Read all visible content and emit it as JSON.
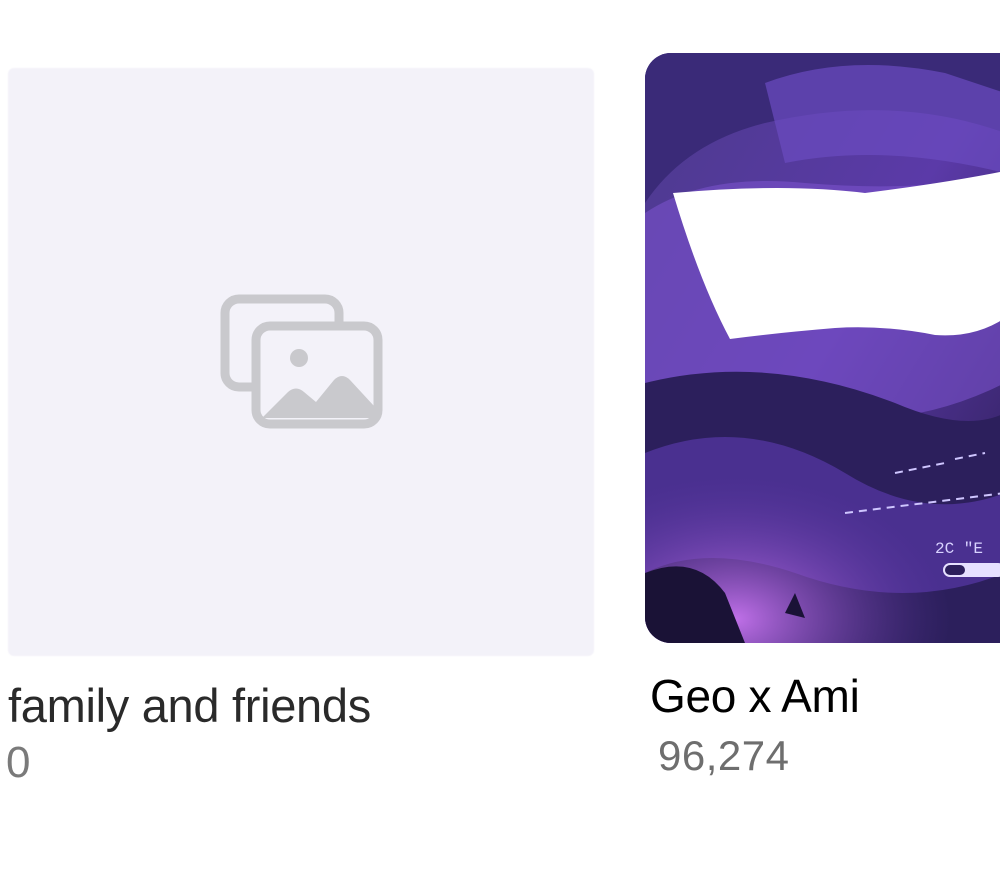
{
  "albums": [
    {
      "title": "family and friends",
      "count": "0",
      "cover": "placeholder-photos-icon"
    },
    {
      "title": "Geo x Ami",
      "count": "96,274",
      "cover": "purple-helmet-artwork",
      "cover_text": "2C \"E"
    }
  ],
  "colors": {
    "placeholder_bg": "#f3f2f9",
    "placeholder_icon": "#c9c9cd",
    "count_text": "#7a7a7a",
    "artwork_purple": "#6a3fb8"
  }
}
